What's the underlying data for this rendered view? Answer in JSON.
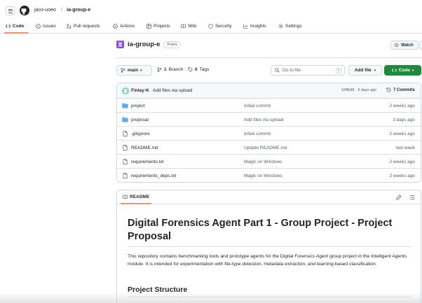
{
  "header": {
    "owner": "jaco-uoeo",
    "separator": "/",
    "repo": "ia-group-e"
  },
  "tabs": [
    {
      "label": "Code",
      "icon": "code-icon",
      "active": true
    },
    {
      "label": "Issues",
      "icon": "issue-icon"
    },
    {
      "label": "Pull requests",
      "icon": "pull-request-icon"
    },
    {
      "label": "Actions",
      "icon": "play-icon"
    },
    {
      "label": "Projects",
      "icon": "table-icon"
    },
    {
      "label": "Wiki",
      "icon": "book-icon"
    },
    {
      "label": "Security",
      "icon": "shield-icon"
    },
    {
      "label": "Insights",
      "icon": "graph-icon"
    },
    {
      "label": "Settings",
      "icon": "gear-icon"
    }
  ],
  "repo": {
    "name": "ia-group-e",
    "visibility": "Public",
    "watch_label": "Watch"
  },
  "toolbar": {
    "branch": "main",
    "branches_count": "1",
    "branches_label": "Branch",
    "tags_count": "0",
    "tags_label": "Tags",
    "search_placeholder": "Go to file",
    "search_shortcut": "t",
    "add_file_label": "Add file",
    "code_label": "Code"
  },
  "latest_commit": {
    "author": "Finlay-K",
    "message": "Add files via upload",
    "hash_time": "16ffb98 · 3 days ago",
    "commits_count": "7 Commits"
  },
  "files": [
    {
      "name": "project",
      "type": "folder",
      "commit": "Initial commit",
      "time": "2 weeks ago"
    },
    {
      "name": "proposal",
      "type": "folder",
      "commit": "Add files via upload",
      "time": "3 days ago"
    },
    {
      "name": ".gitignore",
      "type": "file",
      "commit": "Initial commit",
      "time": "2 weeks ago"
    },
    {
      "name": "README.md",
      "type": "file",
      "commit": "Update README.md",
      "time": "last week"
    },
    {
      "name": "requirements.txt",
      "type": "file",
      "commit": "Magic on Windows",
      "time": "2 weeks ago"
    },
    {
      "name": "requirements_deps.txt",
      "type": "file",
      "commit": "Magic on Windows",
      "time": "2 weeks ago"
    }
  ],
  "readme": {
    "tab_label": "README",
    "title": "Digital Forensics Agent Part 1 - Group Project - Project Proposal",
    "paragraph": "This repository contains benchmarking tools and prototype agents for the Digital Forensics Agent group project in the Intelligent Agents module. It is intended for experimentation with file-type detection, metadata extraction, and learning-based classification.",
    "section_heading": "Project Structure"
  },
  "colors": {
    "accent_underline": "#fd8c73",
    "code_button": "#1f883d",
    "folder": "#54aeff"
  }
}
